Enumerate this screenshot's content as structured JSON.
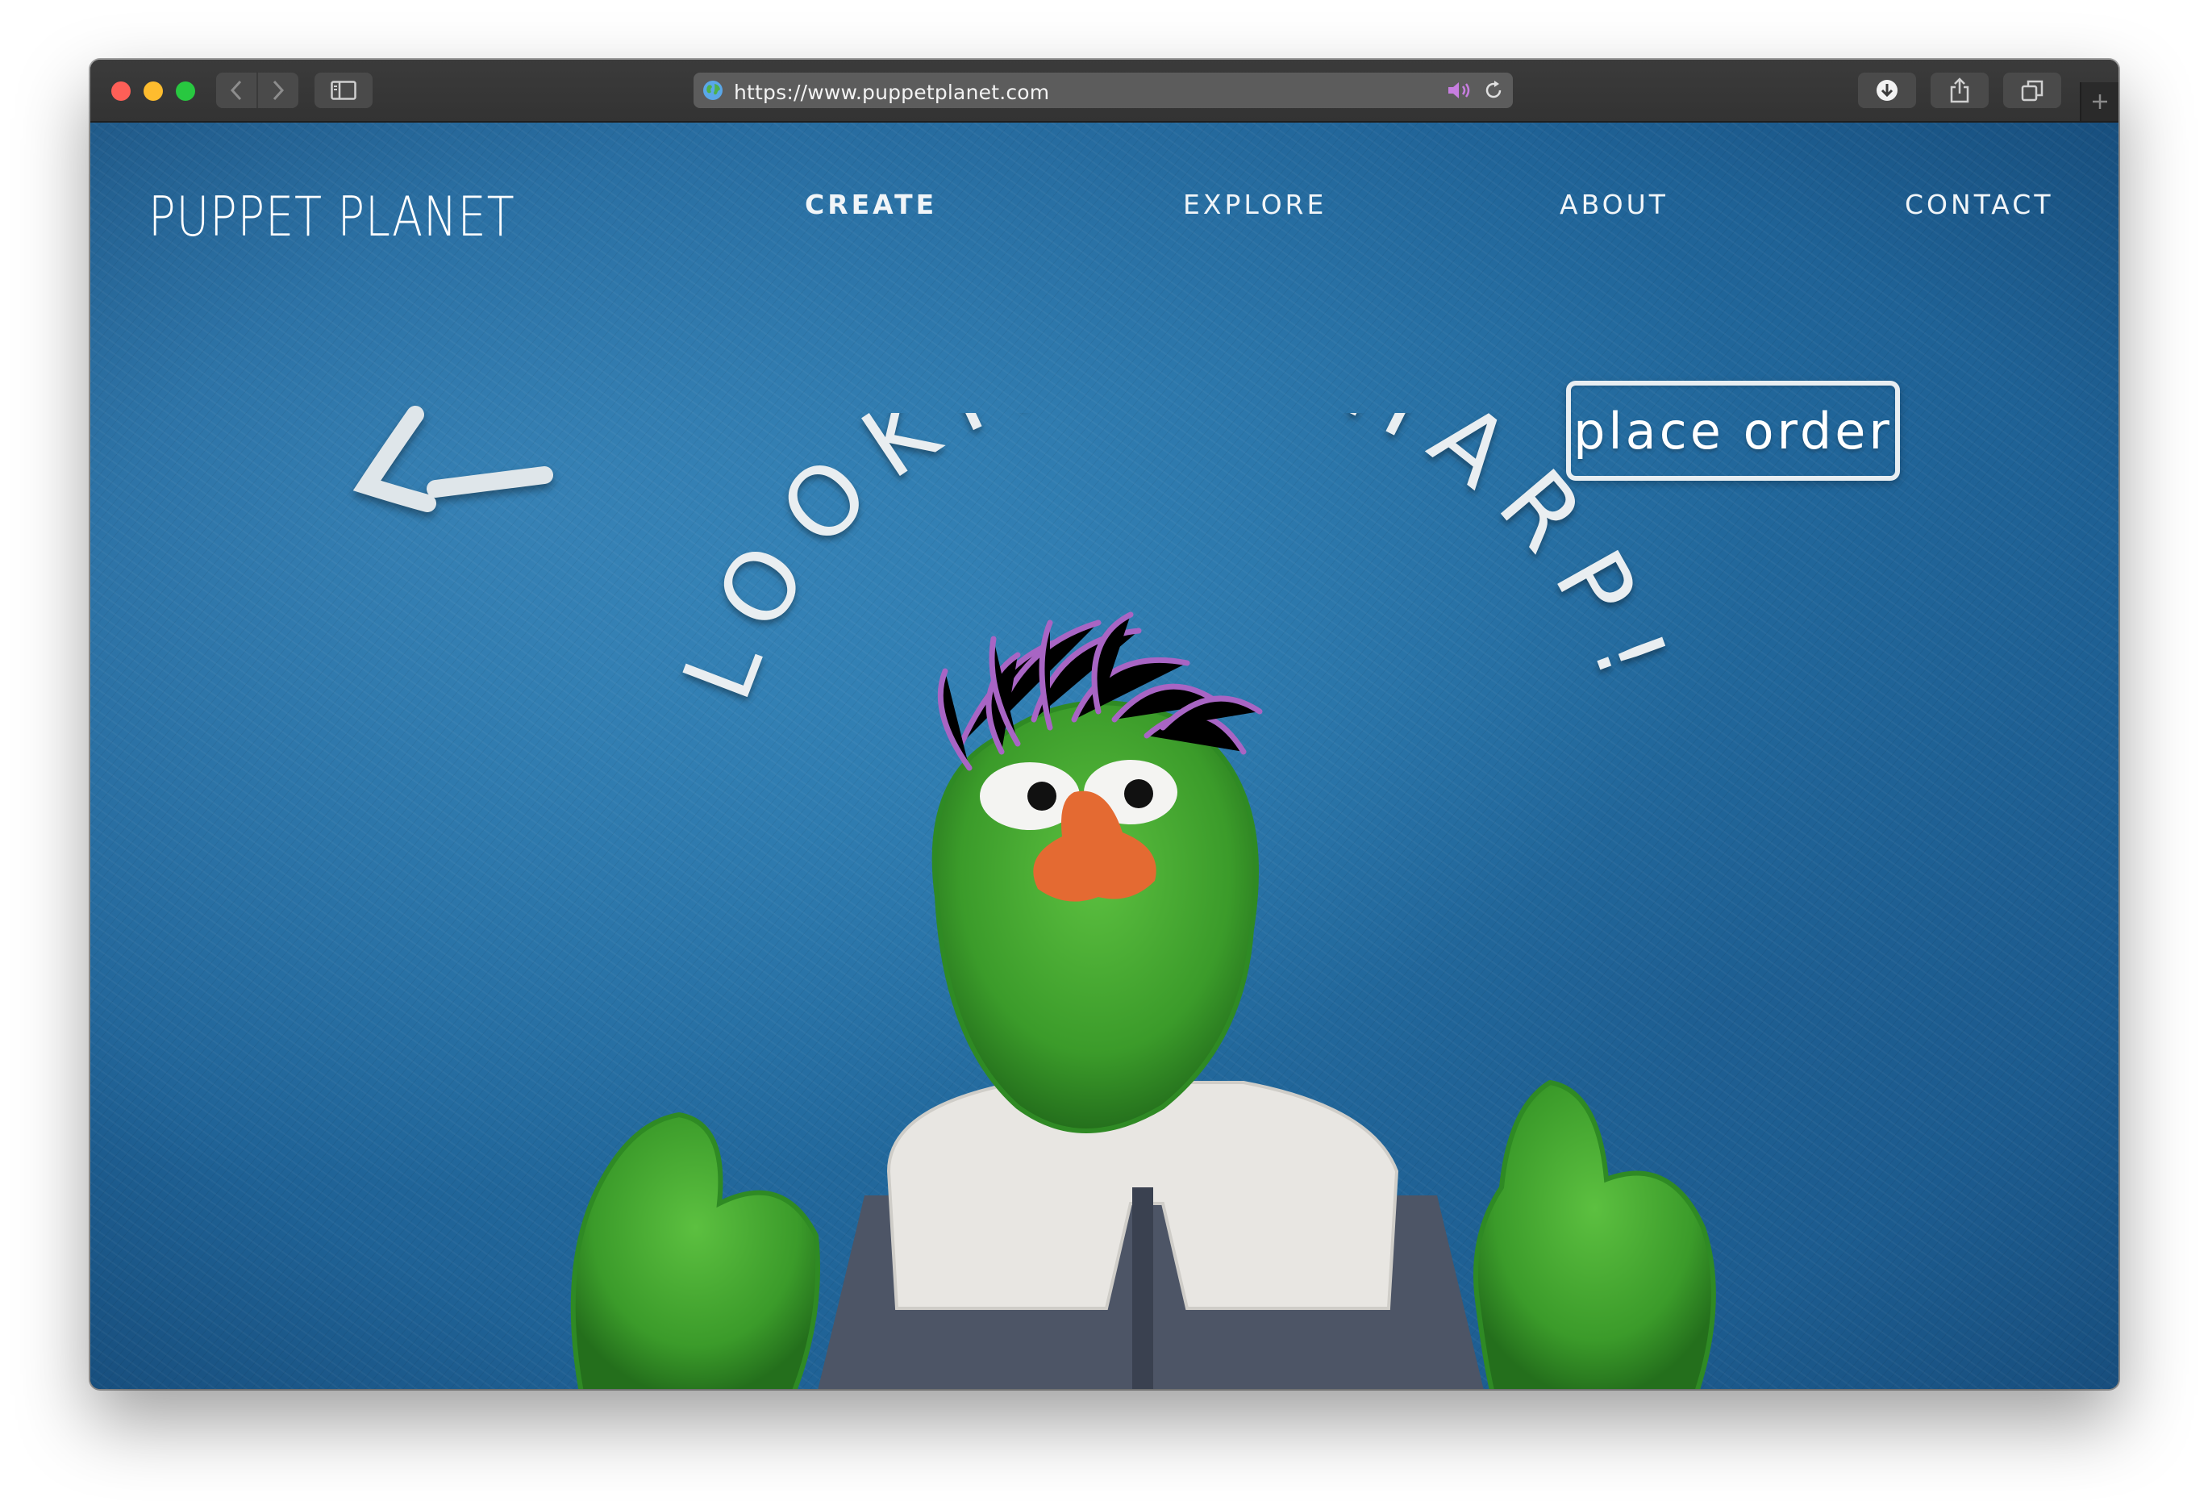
{
  "browser": {
    "url": "https://www.puppetplanet.com",
    "icons": [
      "back-arrow-icon",
      "forward-arrow-icon",
      "sidebar-icon",
      "globe-icon",
      "speaker-icon",
      "reload-icon",
      "download-icon",
      "share-icon",
      "tabs-icon",
      "new-tab-icon"
    ]
  },
  "site": {
    "logo": "PUPPET PLANET",
    "nav": [
      {
        "label": "CREATE",
        "active": true
      },
      {
        "label": "EXPLORE",
        "active": false
      },
      {
        "label": "ABOUT",
        "active": false
      },
      {
        "label": "CONTACT",
        "active": false
      }
    ]
  },
  "hero": {
    "headline": "LOOKING SHARP!",
    "order_button": "place order",
    "back_arrow_icon": "left-arrow-icon"
  },
  "colors": {
    "background": "#2170a8",
    "fur": "#3c9c2a",
    "hair": "#a865c4",
    "nose": "#e46a32",
    "vest_fleece": "#e8e6e2",
    "vest_body": "#4d5566"
  }
}
